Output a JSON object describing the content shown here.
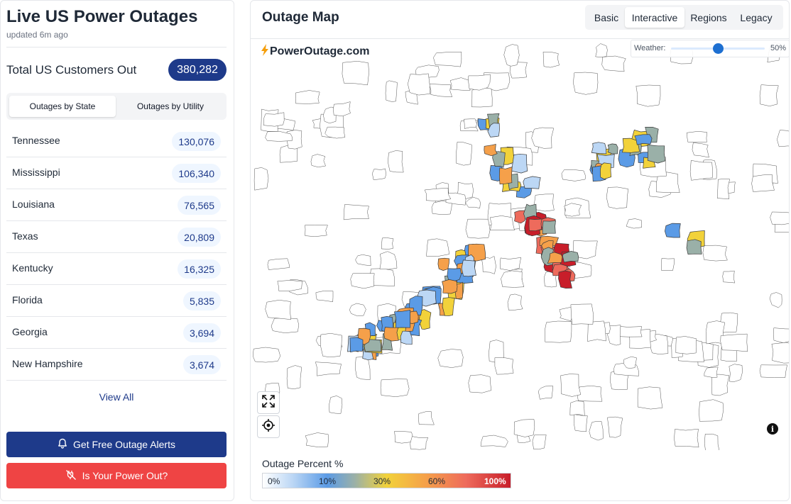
{
  "sidebar": {
    "title": "Live US Power Outages",
    "updated": "updated 6m ago",
    "total_label": "Total US Customers Out",
    "total_value": "380,282",
    "tabs": [
      "Outages by State",
      "Outages by Utility"
    ],
    "active_tab": "Outages by State",
    "states": [
      {
        "name": "Tennessee",
        "value": "130,076"
      },
      {
        "name": "Mississippi",
        "value": "106,340"
      },
      {
        "name": "Louisiana",
        "value": "76,565"
      },
      {
        "name": "Texas",
        "value": "20,809"
      },
      {
        "name": "Kentucky",
        "value": "16,325"
      },
      {
        "name": "Florida",
        "value": "5,835"
      },
      {
        "name": "Georgia",
        "value": "3,694"
      },
      {
        "name": "New Hampshire",
        "value": "3,674"
      }
    ],
    "view_all": "View All",
    "alerts_button": "Get Free Outage Alerts",
    "power_out_button": "Is Your Power Out?"
  },
  "map": {
    "title": "Outage Map",
    "modes": [
      "Basic",
      "Interactive",
      "Regions",
      "Legacy"
    ],
    "active_mode": "Interactive",
    "brand": "PowerOutage.com",
    "weather_label": "Weather:",
    "weather_value": "50%",
    "weather_level": 0.5,
    "legend_title": "Outage Percent %",
    "legend_ticks": [
      "0%",
      "10%",
      "30%",
      "60%",
      "100%"
    ],
    "info_symbol": "i",
    "icons": [
      "bell-icon",
      "no-power-plug-icon",
      "fullscreen-icon",
      "locate-icon",
      "info-icon",
      "lightning-icon"
    ]
  },
  "colors": {
    "primary": "#1e3a8a",
    "danger": "#ef4444",
    "scale": [
      "#ffffff",
      "#bcd7f5",
      "#5b9be6",
      "#9ab0a8",
      "#f2d23a",
      "#f5a04a",
      "#ee6b5c",
      "#c81e2a"
    ]
  }
}
